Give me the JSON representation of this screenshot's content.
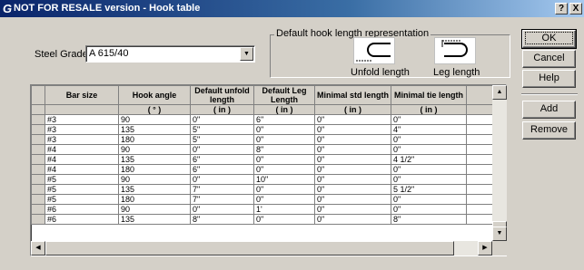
{
  "window": {
    "logo": "G",
    "title": "NOT FOR RESALE version - Hook table",
    "help_btn": "?",
    "close_btn": "X"
  },
  "steel_grade": {
    "label": "Steel Grade",
    "value": "A 615/40"
  },
  "hook_repr": {
    "legend": "Default hook length representation",
    "unfold_label": "Unfold length",
    "leg_label": "Leg length"
  },
  "buttons": {
    "ok": "OK",
    "cancel": "Cancel",
    "help": "Help",
    "add": "Add",
    "remove": "Remove"
  },
  "table": {
    "headers": [
      "Bar size",
      "Hook angle",
      "Default unfold length",
      "Default Leg Length",
      "Minimal std length",
      "Minimal tie length"
    ],
    "units": [
      "",
      "( ° )",
      "( in )",
      "( in )",
      "( in )",
      "( in )"
    ],
    "rows": [
      [
        "#3",
        "90",
        "0\"",
        "6\"",
        "0\"",
        "0\""
      ],
      [
        "#3",
        "135",
        "5\"",
        "0\"",
        "0\"",
        "4\""
      ],
      [
        "#3",
        "180",
        "5\"",
        "0\"",
        "0\"",
        "0\""
      ],
      [
        "#4",
        "90",
        "0\"",
        "8\"",
        "0\"",
        "0\""
      ],
      [
        "#4",
        "135",
        "6\"",
        "0\"",
        "0\"",
        "4 1/2\""
      ],
      [
        "#4",
        "180",
        "6\"",
        "0\"",
        "0\"",
        "0\""
      ],
      [
        "#5",
        "90",
        "0\"",
        "10\"",
        "0\"",
        "0\""
      ],
      [
        "#5",
        "135",
        "7\"",
        "0\"",
        "0\"",
        "5 1/2\""
      ],
      [
        "#5",
        "180",
        "7\"",
        "0\"",
        "0\"",
        "0\""
      ],
      [
        "#6",
        "90",
        "0\"",
        "1'",
        "0\"",
        "0\""
      ],
      [
        "#6",
        "135",
        "8\"",
        "0\"",
        "0\"",
        "8\""
      ]
    ]
  }
}
